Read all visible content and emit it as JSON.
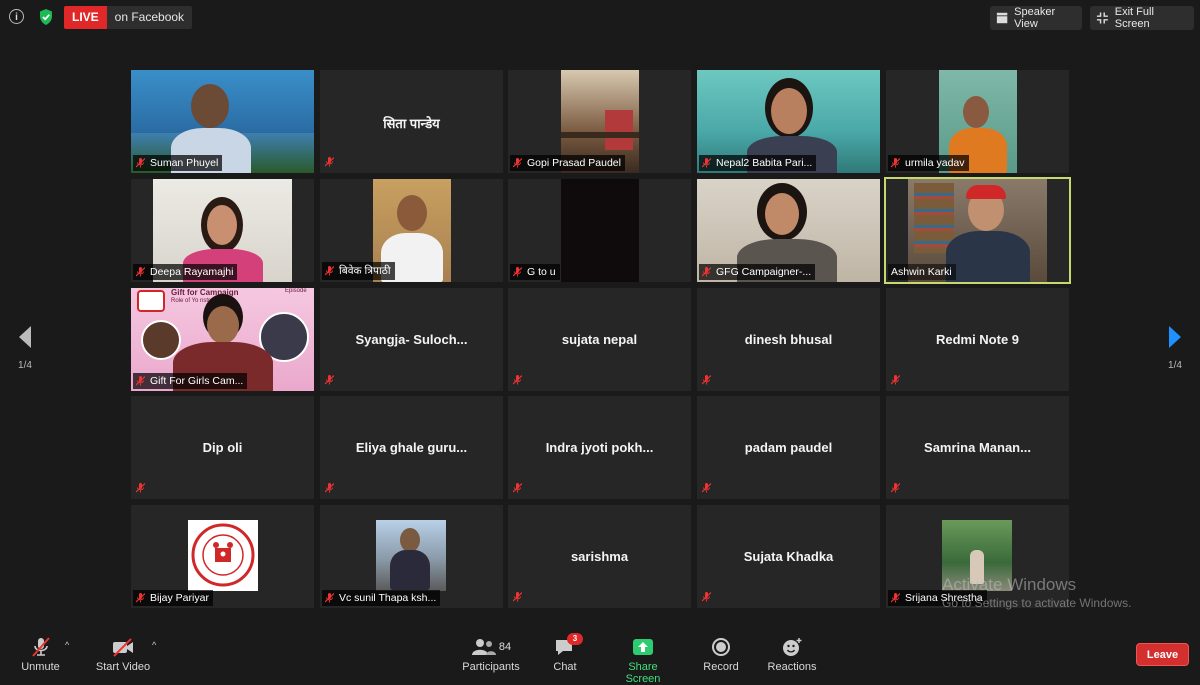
{
  "topbar": {
    "live_label": "LIVE",
    "live_target": "on Facebook",
    "speaker_view_label": "Speaker View",
    "exit_fullscreen_label": "Exit Full Screen"
  },
  "grid": {
    "rows": [
      [
        {
          "name": "Suman Phuyel",
          "video": true
        },
        {
          "name": "सिता पान्डेय",
          "video": false
        },
        {
          "name": "Gopi Prasad Paudel",
          "video": true
        },
        {
          "name": "Nepal2 Babita Pari...",
          "video": true
        },
        {
          "name": "urmila yadav",
          "video": true
        }
      ],
      [
        {
          "name": "Deepa Rayamajhi",
          "video": true
        },
        {
          "name": "बिवेक त्रिपाठी",
          "video": true
        },
        {
          "name": "G to u",
          "video": true
        },
        {
          "name": "GFG Campaigner-...",
          "video": true
        },
        {
          "name": "Ashwin Karki",
          "video": true,
          "active": true
        }
      ],
      [
        {
          "name": "Gift For Girls Cam...",
          "video": true
        },
        {
          "name": "Syangja-  Suloch...",
          "video": false
        },
        {
          "name": "sujata nepal",
          "video": false
        },
        {
          "name": "dinesh bhusal",
          "video": false
        },
        {
          "name": "Redmi Note 9",
          "video": false
        }
      ],
      [
        {
          "name": "Dip oli",
          "video": false
        },
        {
          "name": "Eliya  ghale  guru...",
          "video": false
        },
        {
          "name": "Indra  jyoti  pokh...",
          "video": false
        },
        {
          "name": "padam paudel",
          "video": false
        },
        {
          "name": "Samrina  Manan...",
          "video": false
        }
      ],
      [
        {
          "name": "Bijay Pariyar",
          "video": true
        },
        {
          "name": "Vc sunil Thapa ksh...",
          "video": true
        },
        {
          "name": "sarishma",
          "video": false
        },
        {
          "name": "Sujata Khadka",
          "video": false
        },
        {
          "name": "Srijana Shrestha",
          "video": true
        }
      ]
    ]
  },
  "nav": {
    "left_page": "1/4",
    "right_page": "1/4"
  },
  "slide": {
    "title": "Gift for  Campaign",
    "subtitle": "Role of Yo          nstruction",
    "tag": "Episode"
  },
  "logo_text": "Gift for Girls",
  "toolbar": {
    "unmute": "Unmute",
    "start_video": "Start Video",
    "participants": "Participants",
    "participants_count": "84",
    "chat": "Chat",
    "chat_count": "3",
    "share_screen": "Share Screen",
    "record": "Record",
    "reactions": "Reactions",
    "leave": "Leave"
  },
  "watermark": {
    "line1": "Activate Windows",
    "line2": "Go to Settings to activate Windows."
  },
  "colors": {
    "live_red": "#e02828",
    "share_green": "#2ecc71",
    "active_speaker_border": "#c7d86e",
    "next_arrow": "#1e90ff",
    "leave_red": "#d32f2f"
  }
}
